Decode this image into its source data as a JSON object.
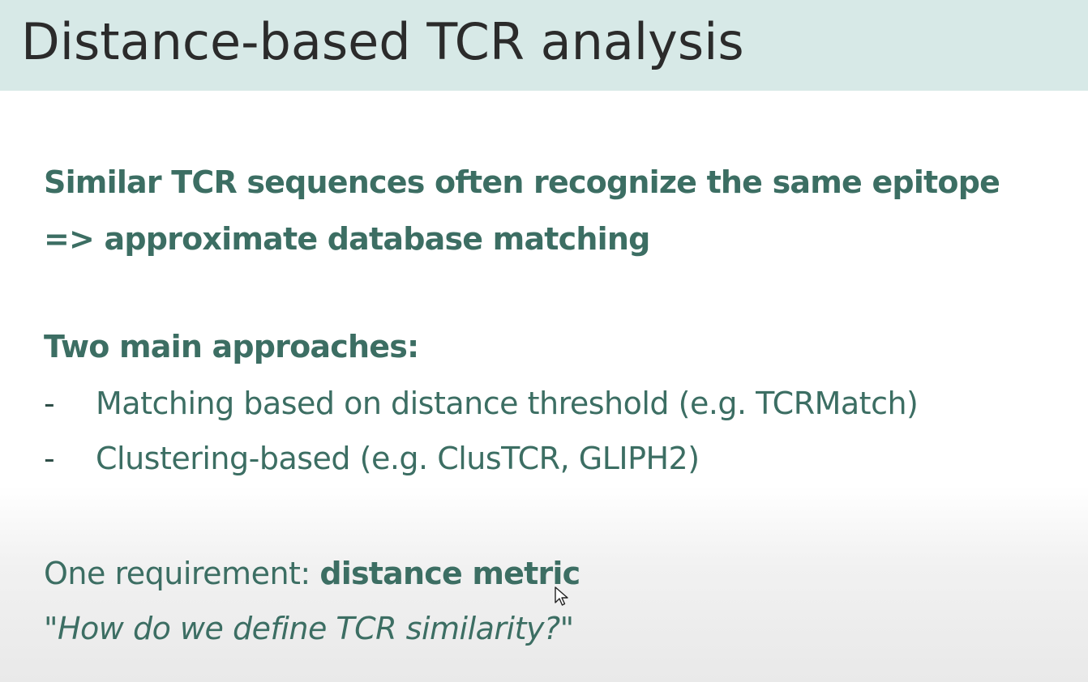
{
  "slide": {
    "title": "Distance-based TCR analysis",
    "headline_lines": [
      "Similar TCR sequences often recognize the same epitope",
      "=> approximate database matching"
    ],
    "section_title": "Two main approaches:",
    "bullets": [
      {
        "dash": "-",
        "text": "Matching based on distance threshold (e.g. TCRMatch)"
      },
      {
        "dash": "-",
        "text": "Clustering-based (e.g. ClusTCR, GLIPH2)"
      }
    ],
    "requirement_prefix": "One requirement: ",
    "requirement_bold": "distance metric",
    "question": "\"How do we define TCR similarity?\""
  },
  "colors": {
    "title_bar": "#d7e9e7",
    "title_text": "#2b2b2b",
    "accent_text": "#3c6e63"
  },
  "icons": {
    "cursor": "mouse-pointer-icon"
  }
}
